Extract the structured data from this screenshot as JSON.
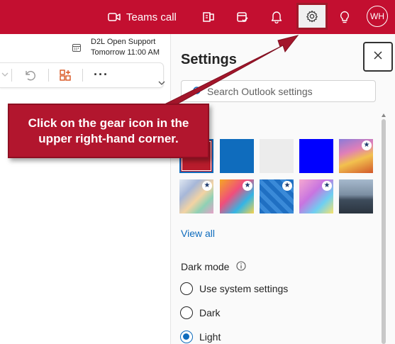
{
  "topbar": {
    "teams_call_label": "Teams call",
    "avatar_initials": "WH",
    "accent": "#c30f30"
  },
  "event": {
    "title": "D2L Open Support",
    "time": "Tomorrow 11:00 AM"
  },
  "settings": {
    "title": "Settings",
    "search_placeholder": "Search Outlook settings",
    "view_all": "View all",
    "dark_mode_label": "Dark mode",
    "radio_options": [
      {
        "label": "Use system settings",
        "selected": false
      },
      {
        "label": "Dark",
        "selected": false
      },
      {
        "label": "Light",
        "selected": true
      }
    ],
    "themes": [
      {
        "name": "red",
        "selected": true,
        "starred": false
      },
      {
        "name": "blue",
        "selected": false,
        "starred": false
      },
      {
        "name": "light-gray",
        "selected": false,
        "starred": false
      },
      {
        "name": "bright-blue",
        "selected": false,
        "starred": false
      },
      {
        "name": "pastel-wave",
        "selected": false,
        "starred": true
      },
      {
        "name": "rainbow-swirl",
        "selected": false,
        "starred": true
      },
      {
        "name": "colorful-illustration",
        "selected": false,
        "starred": true
      },
      {
        "name": "blue-pattern",
        "selected": false,
        "starred": true
      },
      {
        "name": "pink-game",
        "selected": false,
        "starred": true
      },
      {
        "name": "mountain",
        "selected": false,
        "starred": false
      }
    ]
  },
  "callout": {
    "text": "Click on the gear icon in the upper right-hand corner."
  }
}
